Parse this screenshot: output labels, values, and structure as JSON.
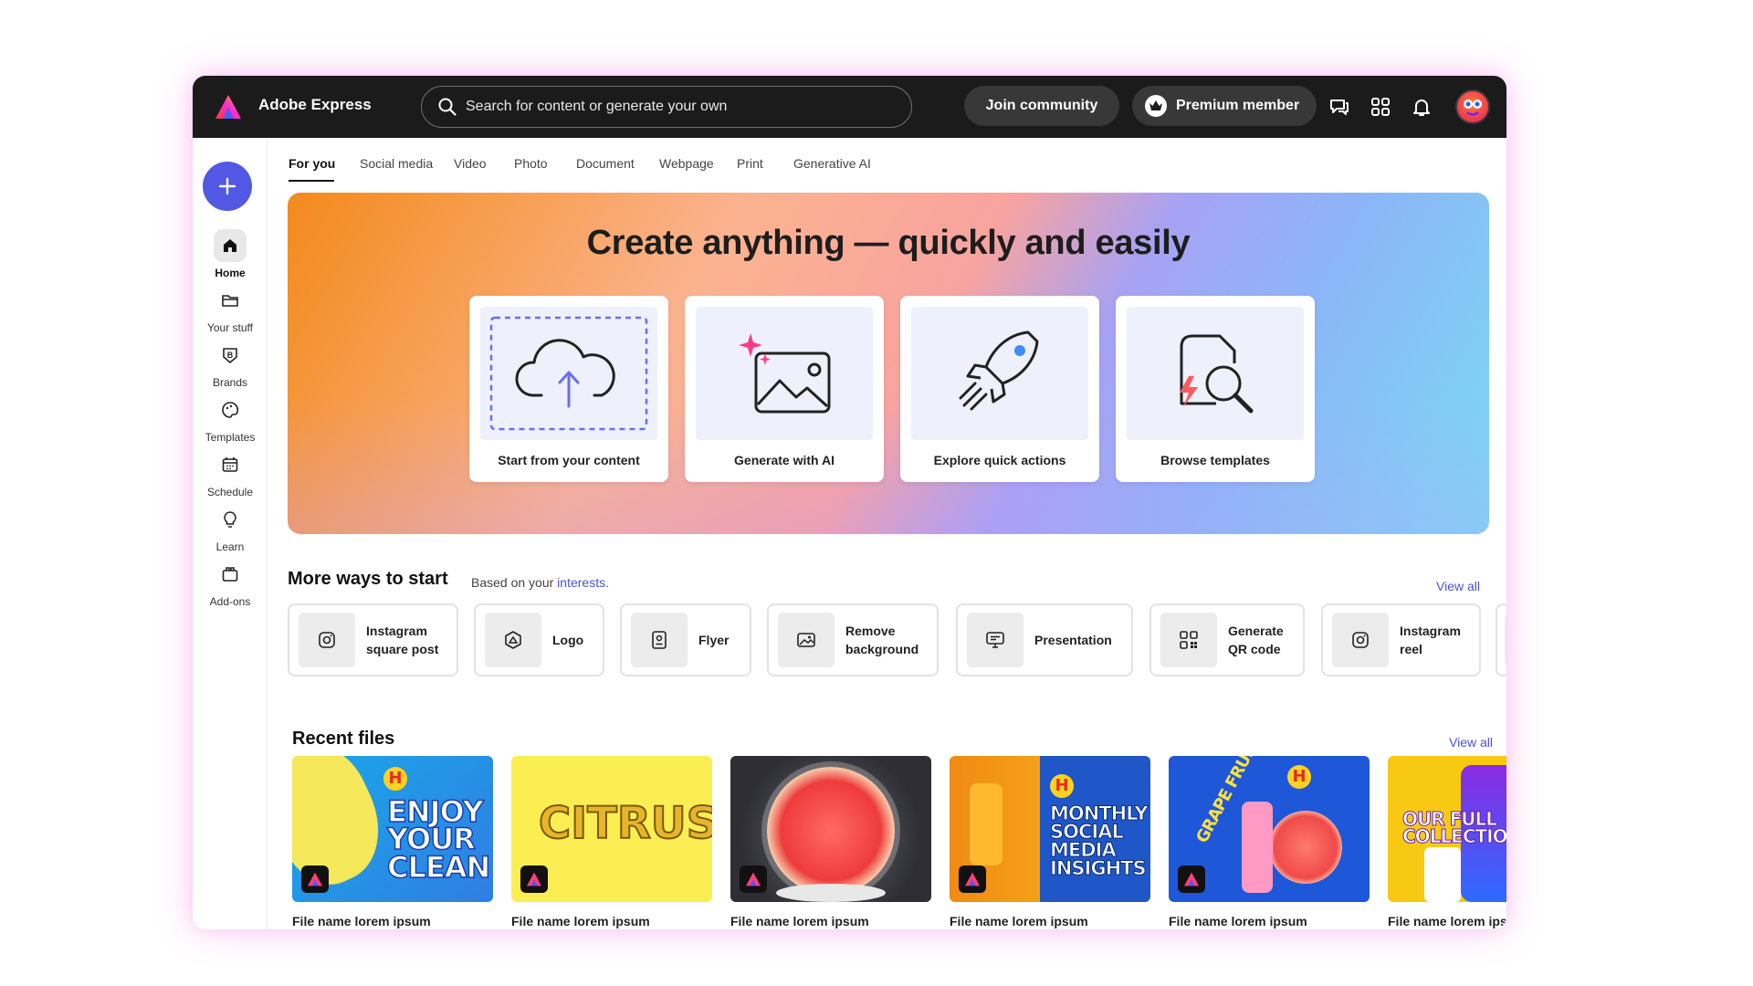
{
  "app": {
    "title": "Adobe Express"
  },
  "search": {
    "placeholder": "Search for content or generate your own"
  },
  "header": {
    "join_label": "Join community",
    "premium_label": "Premium member"
  },
  "sidebar": {
    "items": [
      {
        "label": "Home"
      },
      {
        "label": "Your stuff"
      },
      {
        "label": "Brands"
      },
      {
        "label": "Templates"
      },
      {
        "label": "Schedule"
      },
      {
        "label": "Learn"
      },
      {
        "label": "Add-ons"
      }
    ]
  },
  "tabs": [
    "For you",
    "Social media",
    "Video",
    "Photo",
    "Document",
    "Webpage",
    "Print",
    "Generative AI"
  ],
  "hero": {
    "title": "Create anything — quickly and easily",
    "cards": [
      {
        "label": "Start from your content",
        "icon": "cloud-upload-icon"
      },
      {
        "label": "Generate with AI",
        "icon": "image-sparkle-icon"
      },
      {
        "label": "Explore quick actions",
        "icon": "rocket-icon"
      },
      {
        "label": "Browse templates",
        "icon": "template-search-icon"
      }
    ]
  },
  "more_ways": {
    "title": "More ways to start",
    "subtitle_prefix": "Based on your ",
    "subtitle_link": "interests.",
    "view_all": "View all",
    "items": [
      {
        "line1": "Instagram",
        "line2": "square post"
      },
      {
        "line1": "Logo",
        "line2": ""
      },
      {
        "line1": "Flyer",
        "line2": ""
      },
      {
        "line1": "Remove",
        "line2": "background"
      },
      {
        "line1": "Presentation",
        "line2": ""
      },
      {
        "line1": "Generate",
        "line2": "QR code"
      },
      {
        "line1": "Instagram",
        "line2": "reel"
      }
    ]
  },
  "recent_files": {
    "title": "Recent files",
    "view_all": "View all",
    "files": [
      {
        "name": "File name lorem ipsum",
        "poster": "ENJOY YOUR CLEAN"
      },
      {
        "name": "File name lorem ipsum",
        "poster": "CITRUS"
      },
      {
        "name": "File name lorem ipsum",
        "poster": ""
      },
      {
        "name": "File name lorem ipsum",
        "poster": "MONTHLY SOCIAL MEDIA INSIGHTS"
      },
      {
        "name": "File name lorem ipsum",
        "poster": "GRAPE FRUIT"
      },
      {
        "name": "File name lorem ipsum",
        "poster": "OUR FULL COLLECTION"
      }
    ]
  },
  "colors": {
    "accent": "#5258e4",
    "topbar": "#1b1b1b",
    "link": "#4a52d8"
  }
}
